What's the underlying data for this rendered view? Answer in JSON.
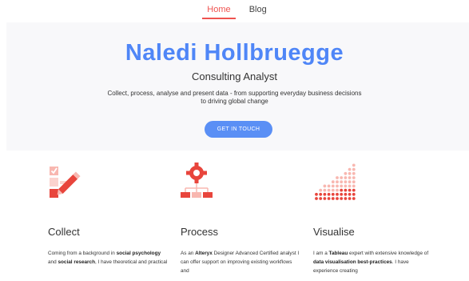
{
  "nav": {
    "items": [
      "Home",
      "Blog"
    ],
    "active": "Home"
  },
  "hero": {
    "name": "Naledi Hollbruegge",
    "role": "Consulting Analyst",
    "tagline_line1": "Collect, process, analyse and present data - from supporting everyday business decisions",
    "tagline_line2": "to driving global change",
    "cta_label": "GET IN TOUCH"
  },
  "columns": [
    {
      "title": "Collect",
      "icon": "checklist-pencil-icon",
      "desc": [
        {
          "t": "Coming from a background in "
        },
        {
          "t": "social",
          "b": true
        },
        {
          "t": "psychology",
          "b": true
        },
        {
          "t": " and "
        },
        {
          "t": "social research",
          "b": true
        },
        {
          "t": ", I have theoretical and practical"
        }
      ]
    },
    {
      "title": "Process",
      "icon": "gear-flowchart-icon",
      "desc": [
        {
          "t": "As an "
        },
        {
          "t": "Alteryx",
          "b": true
        },
        {
          "t": " Designer Advanced Certified analyst I can offer support on improving existing workflows and"
        }
      ]
    },
    {
      "title": "Visualise",
      "icon": "dot-chart-icon",
      "desc": [
        {
          "t": "I am a "
        },
        {
          "t": "Tableau",
          "b": true
        },
        {
          "t": " expert with extensive knowledge of "
        },
        {
          "t": "data visualisation best-practices",
          "b": true
        },
        {
          "t": ". I have experience creating"
        }
      ]
    }
  ],
  "colors": {
    "accent": "#4f86f7",
    "highlight": "#ef5350",
    "icon_light": "#f8b7b0",
    "icon_dark": "#e8453c"
  }
}
